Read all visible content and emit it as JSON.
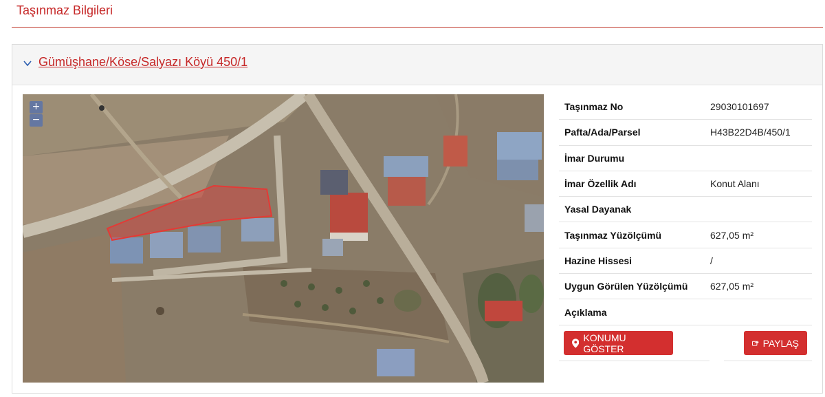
{
  "page": {
    "section_title": "Taşınmaz Bilgileri"
  },
  "card": {
    "title": "Gümüşhane/Köse/Salyazı Köyü 450/1",
    "toggle_icon": "chevron-down-icon"
  },
  "map": {
    "zoom_in": "+",
    "zoom_out": "−",
    "parcel_highlight_color": "#e53935"
  },
  "details": {
    "rows": [
      {
        "label": "Taşınmaz No",
        "value": "29030101697"
      },
      {
        "label": "Pafta/Ada/Parsel",
        "value": "H43B22D4B/450/1"
      },
      {
        "label": "İmar Durumu",
        "value": ""
      },
      {
        "label": "İmar Özellik Adı",
        "value": "Konut Alanı"
      },
      {
        "label": "Yasal Dayanak",
        "value": ""
      },
      {
        "label": "Taşınmaz Yüzölçümü",
        "value": "627,05 m²"
      },
      {
        "label": "Hazine Hissesi",
        "value": "/"
      },
      {
        "label": "Uygun Görülen Yüzölçümü",
        "value": "627,05 m²"
      },
      {
        "label": "Açıklama",
        "value": ""
      }
    ]
  },
  "actions": {
    "show_location": "KONUMU GÖSTER",
    "show_location_icon": "map-marker-icon",
    "share": "PAYLAŞ",
    "share_icon": "share-icon"
  },
  "colors": {
    "accent": "#d32f2f",
    "title": "#c62828"
  }
}
